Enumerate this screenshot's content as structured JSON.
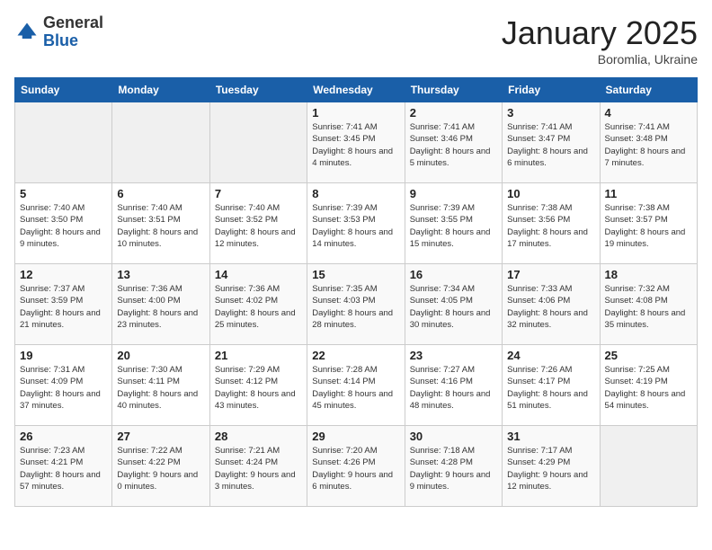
{
  "header": {
    "logo": {
      "general": "General",
      "blue": "Blue"
    },
    "title": "January 2025",
    "subtitle": "Boromlia, Ukraine"
  },
  "weekdays": [
    "Sunday",
    "Monday",
    "Tuesday",
    "Wednesday",
    "Thursday",
    "Friday",
    "Saturday"
  ],
  "weeks": [
    [
      {
        "day": "",
        "sunrise": "",
        "sunset": "",
        "daylight": ""
      },
      {
        "day": "",
        "sunrise": "",
        "sunset": "",
        "daylight": ""
      },
      {
        "day": "",
        "sunrise": "",
        "sunset": "",
        "daylight": ""
      },
      {
        "day": "1",
        "sunrise": "Sunrise: 7:41 AM",
        "sunset": "Sunset: 3:45 PM",
        "daylight": "Daylight: 8 hours and 4 minutes."
      },
      {
        "day": "2",
        "sunrise": "Sunrise: 7:41 AM",
        "sunset": "Sunset: 3:46 PM",
        "daylight": "Daylight: 8 hours and 5 minutes."
      },
      {
        "day": "3",
        "sunrise": "Sunrise: 7:41 AM",
        "sunset": "Sunset: 3:47 PM",
        "daylight": "Daylight: 8 hours and 6 minutes."
      },
      {
        "day": "4",
        "sunrise": "Sunrise: 7:41 AM",
        "sunset": "Sunset: 3:48 PM",
        "daylight": "Daylight: 8 hours and 7 minutes."
      }
    ],
    [
      {
        "day": "5",
        "sunrise": "Sunrise: 7:40 AM",
        "sunset": "Sunset: 3:50 PM",
        "daylight": "Daylight: 8 hours and 9 minutes."
      },
      {
        "day": "6",
        "sunrise": "Sunrise: 7:40 AM",
        "sunset": "Sunset: 3:51 PM",
        "daylight": "Daylight: 8 hours and 10 minutes."
      },
      {
        "day": "7",
        "sunrise": "Sunrise: 7:40 AM",
        "sunset": "Sunset: 3:52 PM",
        "daylight": "Daylight: 8 hours and 12 minutes."
      },
      {
        "day": "8",
        "sunrise": "Sunrise: 7:39 AM",
        "sunset": "Sunset: 3:53 PM",
        "daylight": "Daylight: 8 hours and 14 minutes."
      },
      {
        "day": "9",
        "sunrise": "Sunrise: 7:39 AM",
        "sunset": "Sunset: 3:55 PM",
        "daylight": "Daylight: 8 hours and 15 minutes."
      },
      {
        "day": "10",
        "sunrise": "Sunrise: 7:38 AM",
        "sunset": "Sunset: 3:56 PM",
        "daylight": "Daylight: 8 hours and 17 minutes."
      },
      {
        "day": "11",
        "sunrise": "Sunrise: 7:38 AM",
        "sunset": "Sunset: 3:57 PM",
        "daylight": "Daylight: 8 hours and 19 minutes."
      }
    ],
    [
      {
        "day": "12",
        "sunrise": "Sunrise: 7:37 AM",
        "sunset": "Sunset: 3:59 PM",
        "daylight": "Daylight: 8 hours and 21 minutes."
      },
      {
        "day": "13",
        "sunrise": "Sunrise: 7:36 AM",
        "sunset": "Sunset: 4:00 PM",
        "daylight": "Daylight: 8 hours and 23 minutes."
      },
      {
        "day": "14",
        "sunrise": "Sunrise: 7:36 AM",
        "sunset": "Sunset: 4:02 PM",
        "daylight": "Daylight: 8 hours and 25 minutes."
      },
      {
        "day": "15",
        "sunrise": "Sunrise: 7:35 AM",
        "sunset": "Sunset: 4:03 PM",
        "daylight": "Daylight: 8 hours and 28 minutes."
      },
      {
        "day": "16",
        "sunrise": "Sunrise: 7:34 AM",
        "sunset": "Sunset: 4:05 PM",
        "daylight": "Daylight: 8 hours and 30 minutes."
      },
      {
        "day": "17",
        "sunrise": "Sunrise: 7:33 AM",
        "sunset": "Sunset: 4:06 PM",
        "daylight": "Daylight: 8 hours and 32 minutes."
      },
      {
        "day": "18",
        "sunrise": "Sunrise: 7:32 AM",
        "sunset": "Sunset: 4:08 PM",
        "daylight": "Daylight: 8 hours and 35 minutes."
      }
    ],
    [
      {
        "day": "19",
        "sunrise": "Sunrise: 7:31 AM",
        "sunset": "Sunset: 4:09 PM",
        "daylight": "Daylight: 8 hours and 37 minutes."
      },
      {
        "day": "20",
        "sunrise": "Sunrise: 7:30 AM",
        "sunset": "Sunset: 4:11 PM",
        "daylight": "Daylight: 8 hours and 40 minutes."
      },
      {
        "day": "21",
        "sunrise": "Sunrise: 7:29 AM",
        "sunset": "Sunset: 4:12 PM",
        "daylight": "Daylight: 8 hours and 43 minutes."
      },
      {
        "day": "22",
        "sunrise": "Sunrise: 7:28 AM",
        "sunset": "Sunset: 4:14 PM",
        "daylight": "Daylight: 8 hours and 45 minutes."
      },
      {
        "day": "23",
        "sunrise": "Sunrise: 7:27 AM",
        "sunset": "Sunset: 4:16 PM",
        "daylight": "Daylight: 8 hours and 48 minutes."
      },
      {
        "day": "24",
        "sunrise": "Sunrise: 7:26 AM",
        "sunset": "Sunset: 4:17 PM",
        "daylight": "Daylight: 8 hours and 51 minutes."
      },
      {
        "day": "25",
        "sunrise": "Sunrise: 7:25 AM",
        "sunset": "Sunset: 4:19 PM",
        "daylight": "Daylight: 8 hours and 54 minutes."
      }
    ],
    [
      {
        "day": "26",
        "sunrise": "Sunrise: 7:23 AM",
        "sunset": "Sunset: 4:21 PM",
        "daylight": "Daylight: 8 hours and 57 minutes."
      },
      {
        "day": "27",
        "sunrise": "Sunrise: 7:22 AM",
        "sunset": "Sunset: 4:22 PM",
        "daylight": "Daylight: 9 hours and 0 minutes."
      },
      {
        "day": "28",
        "sunrise": "Sunrise: 7:21 AM",
        "sunset": "Sunset: 4:24 PM",
        "daylight": "Daylight: 9 hours and 3 minutes."
      },
      {
        "day": "29",
        "sunrise": "Sunrise: 7:20 AM",
        "sunset": "Sunset: 4:26 PM",
        "daylight": "Daylight: 9 hours and 6 minutes."
      },
      {
        "day": "30",
        "sunrise": "Sunrise: 7:18 AM",
        "sunset": "Sunset: 4:28 PM",
        "daylight": "Daylight: 9 hours and 9 minutes."
      },
      {
        "day": "31",
        "sunrise": "Sunrise: 7:17 AM",
        "sunset": "Sunset: 4:29 PM",
        "daylight": "Daylight: 9 hours and 12 minutes."
      },
      {
        "day": "",
        "sunrise": "",
        "sunset": "",
        "daylight": ""
      }
    ]
  ]
}
